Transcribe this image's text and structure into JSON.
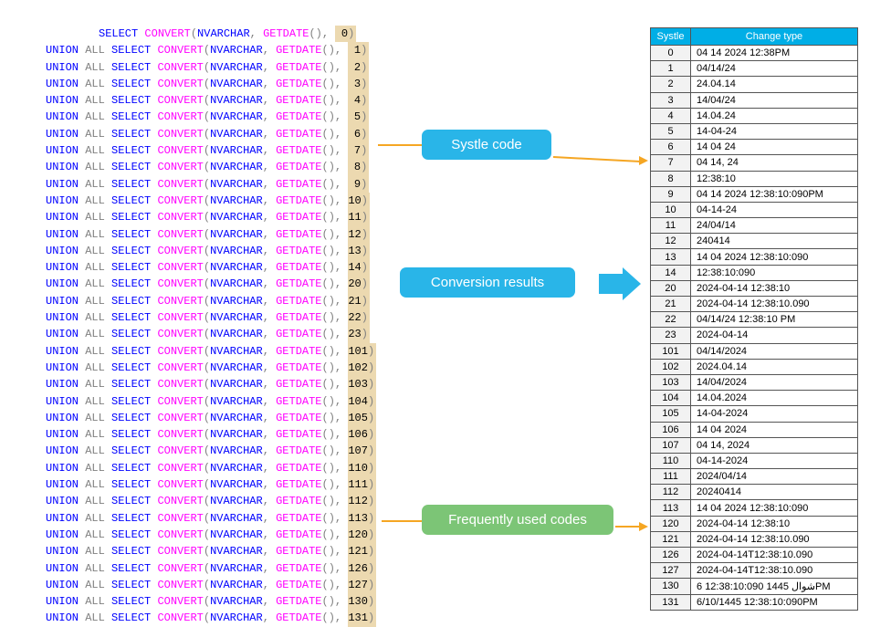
{
  "codes": [
    0,
    1,
    2,
    3,
    4,
    5,
    6,
    7,
    8,
    9,
    10,
    11,
    12,
    13,
    14,
    20,
    21,
    22,
    23,
    101,
    102,
    103,
    104,
    105,
    106,
    107,
    110,
    111,
    112,
    113,
    120,
    121,
    126,
    127,
    130,
    131
  ],
  "table": {
    "header": {
      "col1": "Systle",
      "col2": "Change type"
    },
    "rows": [
      {
        "s": "0",
        "v": "04 14 2024 12:38PM"
      },
      {
        "s": "1",
        "v": "04/14/24"
      },
      {
        "s": "2",
        "v": "24.04.14"
      },
      {
        "s": "3",
        "v": "14/04/24"
      },
      {
        "s": "4",
        "v": "14.04.24"
      },
      {
        "s": "5",
        "v": "14-04-24"
      },
      {
        "s": "6",
        "v": "14 04 24"
      },
      {
        "s": "7",
        "v": "04 14, 24"
      },
      {
        "s": "8",
        "v": "12:38:10"
      },
      {
        "s": "9",
        "v": "04 14 2024 12:38:10:090PM"
      },
      {
        "s": "10",
        "v": "04-14-24"
      },
      {
        "s": "11",
        "v": "24/04/14"
      },
      {
        "s": "12",
        "v": "240414"
      },
      {
        "s": "13",
        "v": "14 04 2024 12:38:10:090"
      },
      {
        "s": "14",
        "v": "12:38:10:090"
      },
      {
        "s": "20",
        "v": "2024-04-14 12:38:10"
      },
      {
        "s": "21",
        "v": "2024-04-14 12:38:10.090"
      },
      {
        "s": "22",
        "v": "04/14/24 12:38:10 PM"
      },
      {
        "s": "23",
        "v": "2024-04-14"
      },
      {
        "s": "101",
        "v": "04/14/2024"
      },
      {
        "s": "102",
        "v": "2024.04.14"
      },
      {
        "s": "103",
        "v": "14/04/2024"
      },
      {
        "s": "104",
        "v": "14.04.2024"
      },
      {
        "s": "105",
        "v": "14-04-2024"
      },
      {
        "s": "106",
        "v": "14 04 2024"
      },
      {
        "s": "107",
        "v": "04 14, 2024"
      },
      {
        "s": "110",
        "v": "04-14-2024"
      },
      {
        "s": "111",
        "v": "2024/04/14"
      },
      {
        "s": "112",
        "v": "20240414"
      },
      {
        "s": "113",
        "v": "14 04 2024 12:38:10:090"
      },
      {
        "s": "120",
        "v": "2024-04-14 12:38:10"
      },
      {
        "s": "121",
        "v": "2024-04-14 12:38:10.090"
      },
      {
        "s": "126",
        "v": "2024-04-14T12:38:10.090"
      },
      {
        "s": "127",
        "v": "2024-04-14T12:38:10.090"
      },
      {
        "s": "130",
        "v": "6 شوال 1445 12:38:10:090PM"
      },
      {
        "s": "131",
        "v": "6/10/1445 12:38:10:090PM"
      }
    ]
  },
  "labels": {
    "systle_code": "Systle code",
    "conversion_results": "Conversion results",
    "frequently_used": "Frequently used codes"
  },
  "sql_parts": {
    "union": "UNION",
    "all": "ALL",
    "select": "SELECT",
    "convert": "CONVERT",
    "nvarchar": "NVARCHAR",
    "getdate": "GETDATE"
  }
}
